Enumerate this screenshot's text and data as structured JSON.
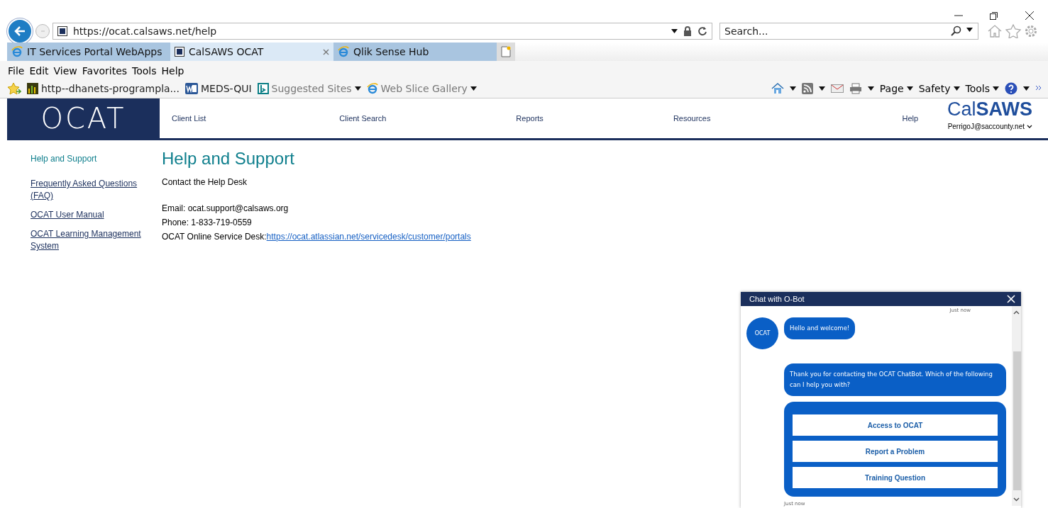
{
  "browser": {
    "url": "https://ocat.calsaws.net/help",
    "search": {
      "placeholder": "Search..."
    },
    "tabs": [
      {
        "label": "IT Services Portal WebApps",
        "selected": false,
        "kind": "ie"
      },
      {
        "label": "CalSAWS OCAT",
        "selected": true,
        "kind": "site"
      },
      {
        "label": "Qlik Sense Hub",
        "selected": false,
        "kind": "ie"
      }
    ],
    "menu": [
      "File",
      "Edit",
      "View",
      "Favorites",
      "Tools",
      "Help"
    ],
    "favorites": [
      {
        "label": "http--dhanets-programpla...",
        "kind": "chart",
        "dropdown": false
      },
      {
        "label": "MEDS-QUI",
        "kind": "word",
        "dropdown": false
      },
      {
        "label": "Suggested Sites",
        "kind": "bing",
        "dropdown": true
      },
      {
        "label": "Web Slice Gallery",
        "kind": "ie",
        "dropdown": true
      }
    ],
    "commands": [
      "Page",
      "Safety",
      "Tools"
    ]
  },
  "site": {
    "logo": "OCAT",
    "nav": [
      "Client List",
      "Client Search",
      "Reports",
      "Resources",
      "Help"
    ],
    "brand": "Cal**SAWS**",
    "user": "PerrigoJ@saccounty.net",
    "sidebar": [
      {
        "label": "Help and Support",
        "selected": true
      },
      {
        "label": "Frequently Asked Questions (FAQ)",
        "selected": false
      },
      {
        "label": "OCAT User Manual",
        "selected": false
      },
      {
        "label": "OCAT Learning Management System",
        "selected": false
      }
    ],
    "title": "Help and Support",
    "subtitle": "Contact the Help Desk",
    "email": "Email: ocat.support@calsaws.org",
    "phone": "Phone: 1-833-719-0559",
    "desk_label": "OCAT Online Service Desk:",
    "desk_link": "https://ocat.atlassian.net/servicedesk/customer/portals"
  },
  "chat": {
    "title": "Chat with O-Bot",
    "time_top": "Just now",
    "avatar": "OCAT",
    "messages": [
      "Hello and welcome!",
      "Thank you for contacting the OCAT ChatBot. Which of the following can I help you with?"
    ],
    "options": [
      "Access to OCAT",
      "Report a Problem",
      "Training Question"
    ],
    "time_bottom": "Just now"
  }
}
